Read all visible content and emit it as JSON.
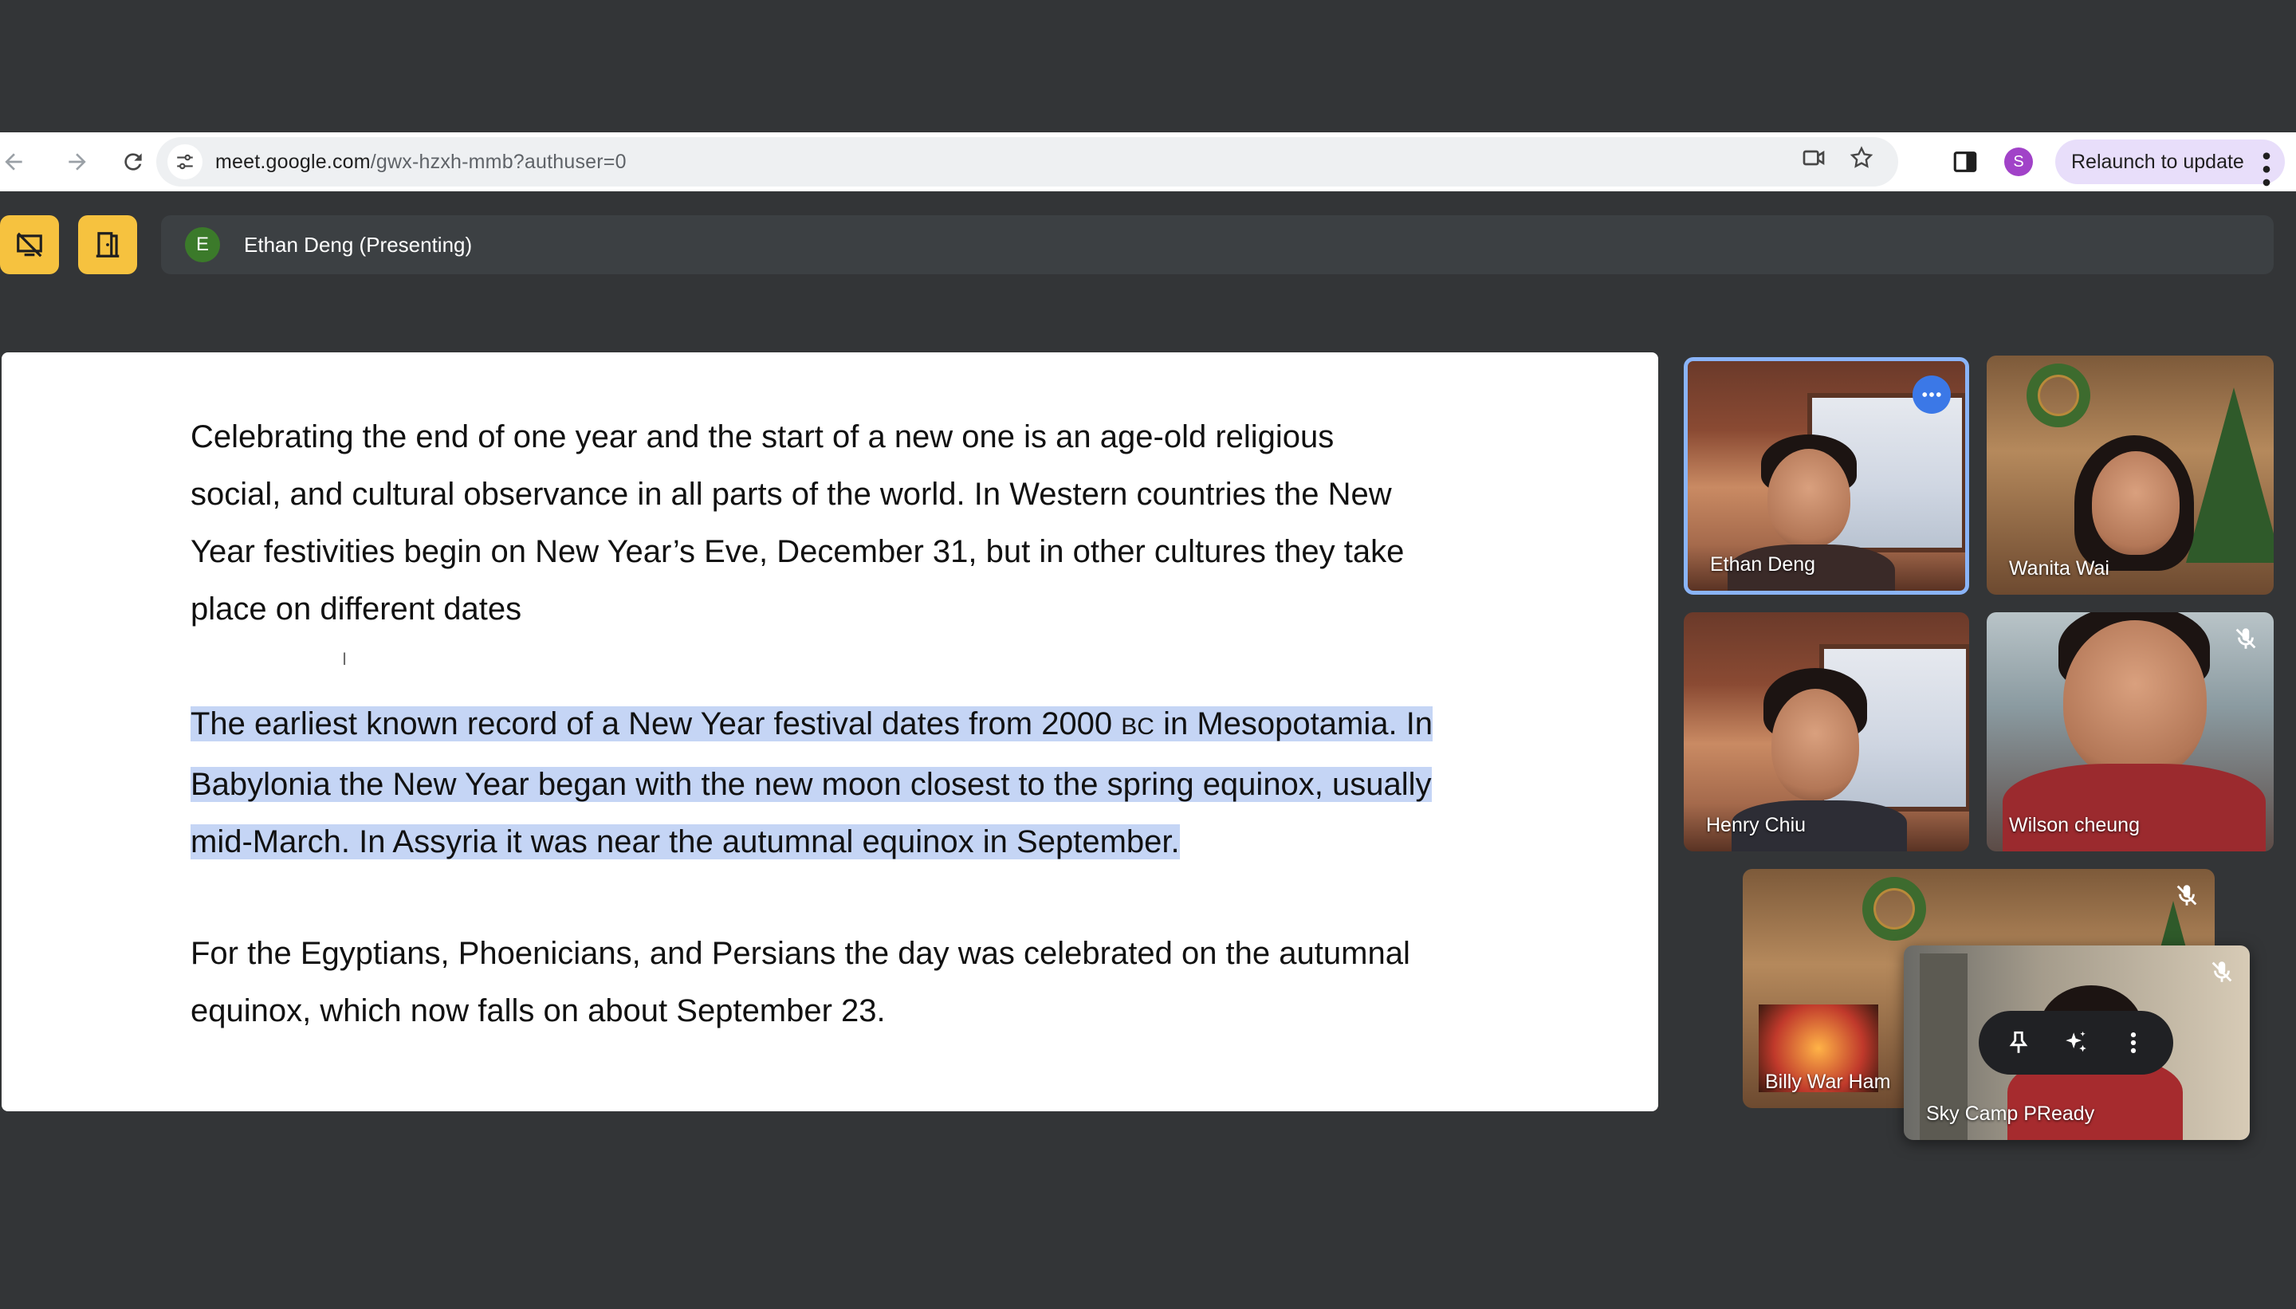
{
  "browser": {
    "url_host": "meet.google.com",
    "url_path": "/gwx-hzxh-mmb?authuser=0",
    "profile_initial": "S",
    "relaunch_label": "Relaunch to update"
  },
  "meet": {
    "presenter_initial": "E",
    "presenter_label": "Ethan Deng (Presenting)"
  },
  "slide": {
    "paragraph1": [
      "Celebrating the end of one year and the start of a new one is an age-old religious",
      "social, and cultural observance in all parts of the world. In Western countries the New",
      "Year festivities begin on New Year’s Eve, December 31, but in other cultures they take",
      "place on different dates"
    ],
    "paragraph2": [
      "The earliest known record of a New Year festival dates from 2000 ",
      "BC",
      " in Mesopotamia. In",
      "Babylonia the New Year began with the new moon closest to the spring equinox, usually",
      "mid-March. In Assyria it was near the autumnal equinox in September."
    ],
    "paragraph3": [
      "For the Egyptians, Phoenicians, and Persians the day was celebrated on the autumnal",
      "equinox, which now falls on about September 23."
    ]
  },
  "participants": [
    {
      "name": "Ethan Deng",
      "muted": false,
      "active": true
    },
    {
      "name": "Wanita Wai",
      "muted": false,
      "active": false
    },
    {
      "name": "Henry Chiu",
      "muted": false,
      "active": false
    },
    {
      "name": "Wilson cheung",
      "muted": true,
      "active": false
    },
    {
      "name": "Billy War Ham",
      "muted": true,
      "active": false
    },
    {
      "name": "Sky Camp PReady",
      "muted": true,
      "active": false
    }
  ],
  "colors": {
    "background": "#333537",
    "highlight": "#c5d5f5",
    "meet_button": "#f6c23f",
    "active_tile_border": "#8ab4f8",
    "relaunch_bg": "#e8defa"
  }
}
